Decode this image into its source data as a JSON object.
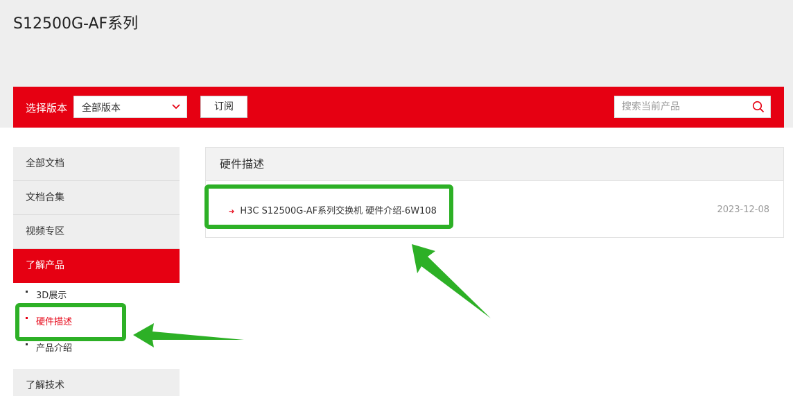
{
  "page": {
    "title": "S12500G-AF系列"
  },
  "toolbar": {
    "version_label": "选择版本",
    "version_selected": "全部版本",
    "subscribe_label": "订阅",
    "search_placeholder": "搜索当前产品"
  },
  "sidebar": {
    "items": [
      {
        "label": "全部文档"
      },
      {
        "label": "文档合集"
      },
      {
        "label": "视频专区"
      },
      {
        "label": "了解产品",
        "active": true
      },
      {
        "label": "了解技术"
      }
    ],
    "sub_items": [
      {
        "label": "3D展示"
      },
      {
        "label": "硬件描述",
        "current": true
      },
      {
        "label": "产品介绍"
      }
    ]
  },
  "main": {
    "section_title": "硬件描述",
    "documents": [
      {
        "title": "H3C S12500G-AF系列交换机 硬件介绍-6W108",
        "date": "2023-12-08"
      }
    ]
  },
  "colors": {
    "brand_red": "#e60012",
    "annotation_green": "#2db026",
    "background_gray": "#eeeeee"
  },
  "icons": {
    "select": "chevron-down-icon",
    "search": "search-icon",
    "bullet": "arrow-right-icon"
  }
}
